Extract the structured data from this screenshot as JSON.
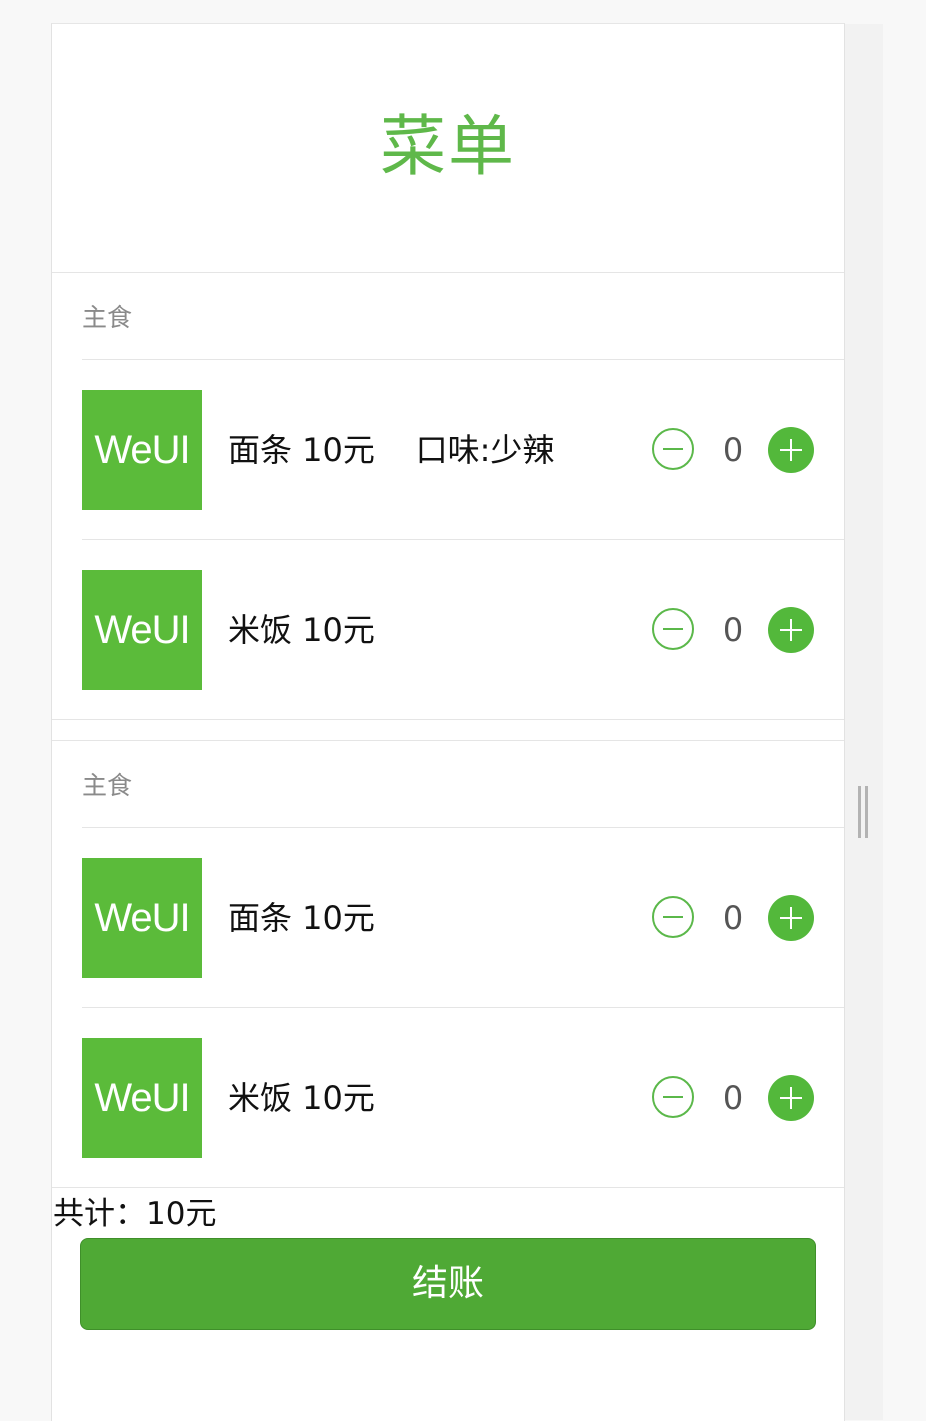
{
  "page": {
    "title": "菜单"
  },
  "groups": [
    {
      "header": "主食",
      "items": [
        {
          "thumb": "WeUI",
          "name": "面条 10元    口味:少辣",
          "qty": "0"
        },
        {
          "thumb": "WeUI",
          "name": "米饭 10元",
          "qty": "0"
        }
      ]
    },
    {
      "header": "主食",
      "items": [
        {
          "thumb": "WeUI",
          "name": "面条 10元",
          "qty": "0"
        },
        {
          "thumb": "WeUI",
          "name": "米饭 10元",
          "qty": "0"
        }
      ]
    }
  ],
  "total": "共计：10元",
  "checkout_label": "结账",
  "colors": {
    "accent": "#5bbb3a",
    "button": "#4fa935"
  }
}
